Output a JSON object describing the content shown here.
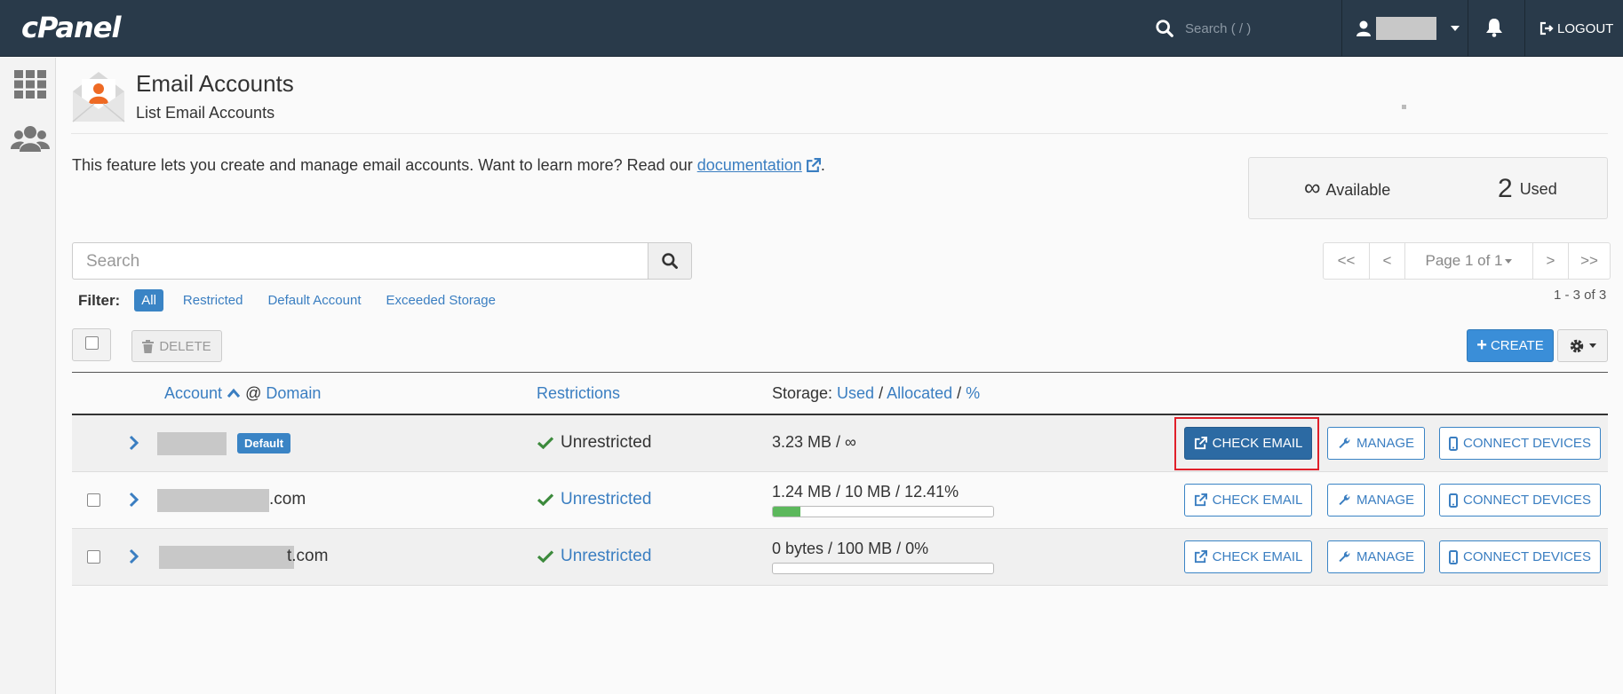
{
  "topbar": {
    "logo": "cPanel",
    "search_placeholder": "Search ( / )",
    "logout_label": "LOGOUT"
  },
  "header": {
    "title": "Email Accounts",
    "subtitle": "List Email Accounts"
  },
  "intro": {
    "text": "This feature lets you create and manage email accounts. Want to learn more? Read our ",
    "link": "documentation",
    "end": "."
  },
  "stats": {
    "available_value": "∞",
    "available_label": "Available",
    "used_value": "2",
    "used_label": "Used"
  },
  "search": {
    "placeholder": "Search"
  },
  "pager": {
    "first": "<<",
    "prev": "<",
    "page_label": "Page 1 of 1",
    "next": ">",
    "last": ">>",
    "count": "1 - 3 of 3"
  },
  "filter": {
    "label": "Filter:",
    "options": [
      "All",
      "Restricted",
      "Default Account",
      "Exceeded Storage"
    ],
    "active": "All"
  },
  "toolbar": {
    "delete_label": "DELETE",
    "create_label": "CREATE"
  },
  "table": {
    "col_account": "Account",
    "col_at": " @ ",
    "col_domain": "Domain",
    "col_restrictions": "Restrictions",
    "col_storage_prefix": "Storage: ",
    "col_storage_used": "Used",
    "col_storage_allocated": "Allocated",
    "col_storage_percent": "%",
    "rows": [
      {
        "suffix": "",
        "badge": "Default",
        "restriction": "Unrestricted",
        "storage": "3.23 MB / ∞",
        "usage_percent": null
      },
      {
        "suffix": ".com",
        "badge": "",
        "restriction": "Unrestricted",
        "storage": "1.24 MB / 10 MB / 12.41%",
        "usage_percent": 12.41
      },
      {
        "suffix": "t.com",
        "badge": "",
        "restriction": "Unrestricted",
        "storage": "0 bytes / 100 MB / 0%",
        "usage_percent": 0
      }
    ],
    "action_check_email": "CHECK EMAIL",
    "action_manage": "MANAGE",
    "action_connect": "CONNECT DEVICES"
  },
  "colors": {
    "topbar_bg": "#293a4a",
    "accent": "#3a84c5",
    "primary_button": "#2c6aa3",
    "success": "#5cb85c",
    "highlight": "#e0202a"
  }
}
